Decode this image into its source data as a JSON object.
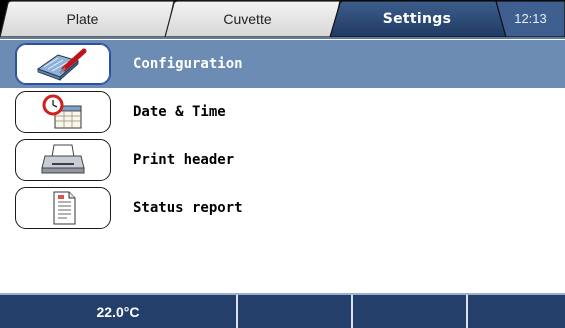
{
  "tabs": [
    {
      "label": "Plate",
      "active": false
    },
    {
      "label": "Cuvette",
      "active": false
    },
    {
      "label": "Settings",
      "active": true
    }
  ],
  "clock": "12:13",
  "menu": {
    "items": [
      {
        "label": "Configuration",
        "icon": "configuration-icon",
        "selected": true
      },
      {
        "label": "Date & Time",
        "icon": "calendar-clock-icon",
        "selected": false
      },
      {
        "label": "Print header",
        "icon": "printer-icon",
        "selected": false
      },
      {
        "label": "Status report",
        "icon": "report-document-icon",
        "selected": false
      }
    ]
  },
  "status_bar": {
    "temperature": "22.0°C"
  },
  "colors": {
    "selected_row": "#6d8cb3",
    "status_bar": "#24406a",
    "active_tab": "#24406a",
    "inactive_tab": "#e3e3e3"
  }
}
